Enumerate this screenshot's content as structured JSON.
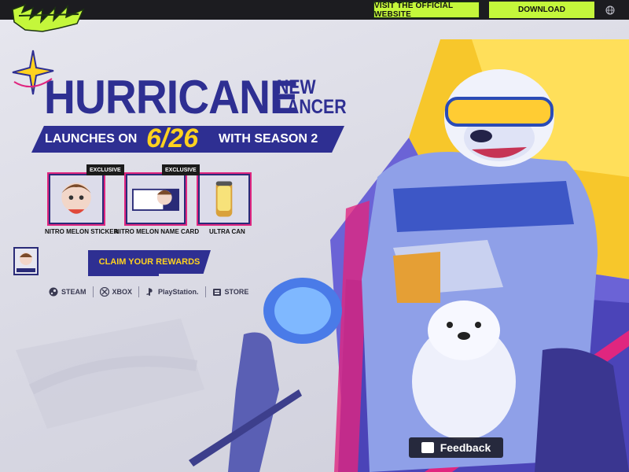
{
  "topbar": {
    "logo_alt": "FRAGPUNK",
    "visit_label": "VISIT THE OFFICIAL WEBSITE",
    "download_label": "DOWNLOAD",
    "language_icon": "globe-icon"
  },
  "hero": {
    "title": "HURRICANE",
    "subtitle_line1": "NEW",
    "subtitle_line2": "LANCER",
    "launch_prefix": "LAUNCHES ON",
    "launch_date": "6/26",
    "launch_suffix": "WITH SEASON 2"
  },
  "rewards": [
    {
      "label": "NITRO MELON STICKER",
      "badge": "EXCLUSIVE"
    },
    {
      "label": "NITRO MELON NAME CARD",
      "badge": "EXCLUSIVE"
    },
    {
      "label": "ULTRA CAN",
      "badge": ""
    }
  ],
  "claim": {
    "button_label": "CLAIM YOUR REWARDS"
  },
  "platforms": [
    {
      "label": "STEAM",
      "icon": "steam-icon"
    },
    {
      "label": "XBOX",
      "icon": "xbox-icon"
    },
    {
      "label": "PlayStation.",
      "icon": "playstation-icon"
    },
    {
      "label": "STORE",
      "icon": "store-icon"
    }
  ],
  "feedback": {
    "label": "Feedback"
  },
  "colors": {
    "accent_green": "#c4f73b",
    "title_navy": "#2e2f92",
    "date_yellow": "#ffd21f",
    "border_pink": "#e0267f"
  }
}
